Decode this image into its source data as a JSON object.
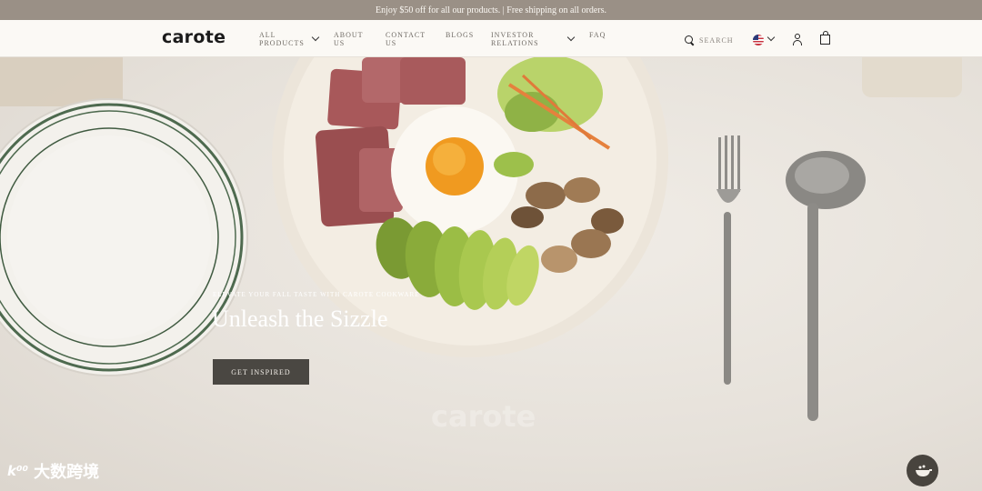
{
  "announcement": "Enjoy $50 off for all our products. | Free shipping on all orders.",
  "header": {
    "logo": "carote",
    "nav": [
      {
        "line1": "ALL",
        "line2": "PRODUCTS"
      },
      {
        "line1": "ABOUT",
        "line2": "US"
      },
      {
        "line1": "CONTACT",
        "line2": "US"
      },
      {
        "line1": "BLOGS",
        "line2": ""
      },
      {
        "line1": "INVESTOR",
        "line2": "RELATIONS"
      },
      {
        "line1": "FAQ",
        "line2": ""
      }
    ],
    "search_label": "SEARCH"
  },
  "hero": {
    "eyebrow": "ELEVATE YOUR FALL TASTE WITH CAROTE COOKWARE",
    "title": "Unleash the Sizzle",
    "cta": "GET INSPIRED",
    "watermark": "carote"
  },
  "overlay": {
    "corner_mark": "k⁰⁰",
    "corner_text": "大数跨境"
  },
  "colors": {
    "announcement_bg": "#9a9086",
    "header_bg": "#fbf9f5",
    "button_bg": "#4a4742",
    "chat_bg": "#48443e"
  }
}
